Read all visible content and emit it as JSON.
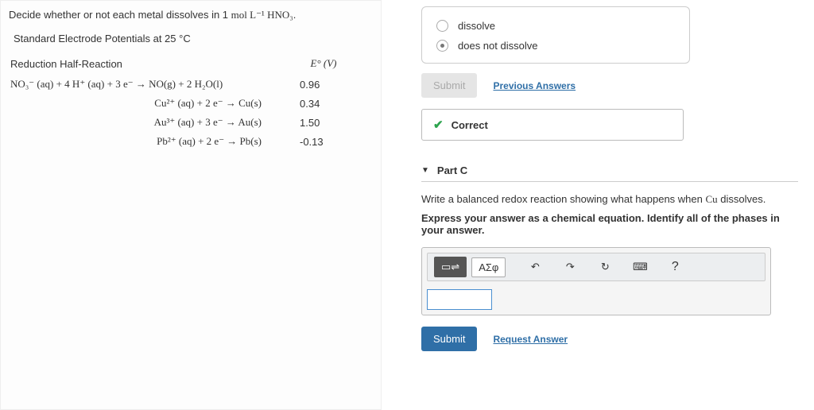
{
  "left": {
    "prompt_prefix": "Decide whether or not each metal dissolves in 1 ",
    "prompt_unit": "mol L⁻¹ HNO₃",
    "prompt_suffix": ".",
    "subtitle": "Standard Electrode Potentials at 25 °C",
    "col1": "Reduction Half-Reaction",
    "col2": "E° (V)",
    "rows": [
      {
        "eq": "NO₃⁻ (aq) + 4 H⁺ (aq) + 3 e⁻  →  NO(g) + 2 H₂O(l)",
        "val": "0.96"
      },
      {
        "eq": "Cu²⁺ (aq) + 2 e⁻  →  Cu(s)",
        "val": "0.34"
      },
      {
        "eq": "Au³⁺ (aq) + 3 e⁻  →  Au(s)",
        "val": "1.50"
      },
      {
        "eq": "Pb²⁺ (aq) + 2 e⁻  →  Pb(s)",
        "val": "-0.13"
      }
    ]
  },
  "options": {
    "a": "dissolve",
    "b": "does not dissolve"
  },
  "buttons": {
    "submit_disabled": "Submit",
    "prev_answers": "Previous Answers",
    "submit": "Submit",
    "request_answer": "Request Answer"
  },
  "feedback": {
    "correct": "Correct"
  },
  "partC": {
    "title": "Part C",
    "q_prefix": "Write a balanced redox reaction showing what happens when ",
    "q_elem": "Cu",
    "q_suffix": " dissolves.",
    "instr": "Express your answer as a chemical equation. Identify all of the phases in your answer."
  },
  "toolbar": {
    "templates": "▭⇌",
    "greek": "ΑΣφ",
    "undo": "↶",
    "redo": "↷",
    "reset": "↻",
    "keyboard": "⌨",
    "help": "?"
  }
}
